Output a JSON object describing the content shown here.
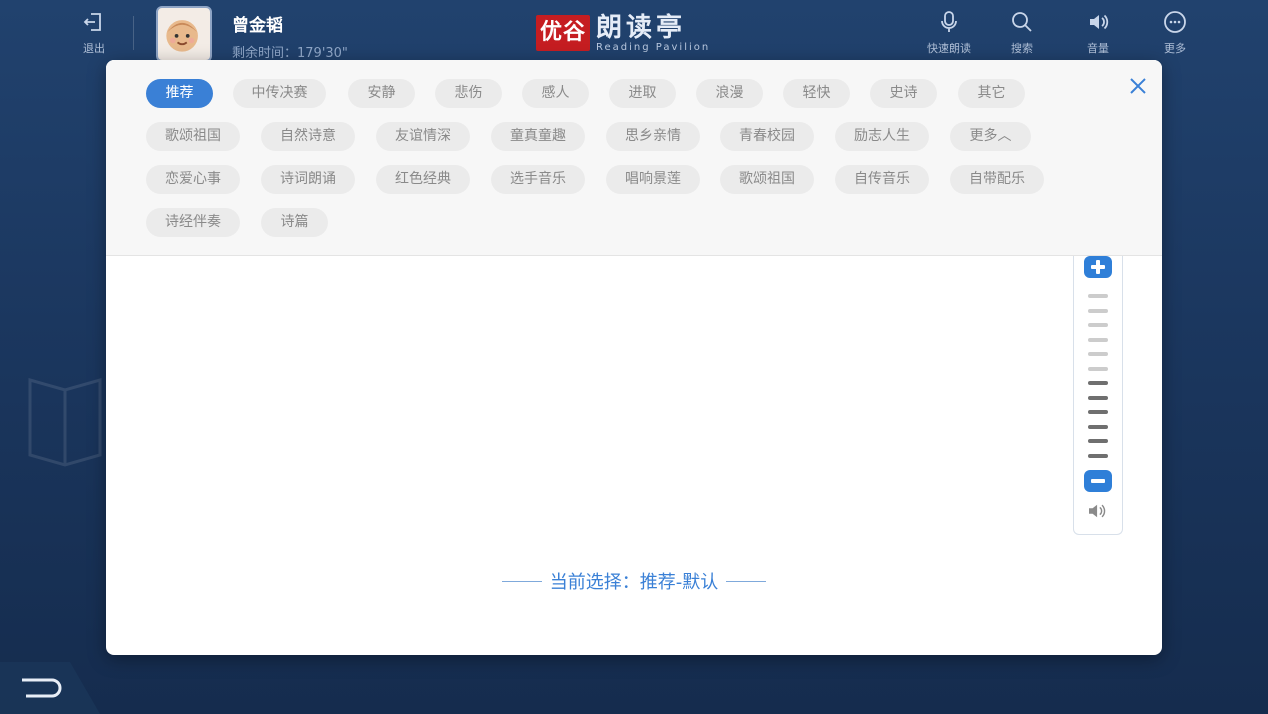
{
  "topbar": {
    "exit_label": "退出",
    "user_name": "曾金韬",
    "remaining_time": "剩余时间：179'30\"",
    "logo_mark": "优谷",
    "logo_cn": "朗读亭",
    "logo_en": "Reading Pavilion",
    "actions": [
      {
        "label": "快速朗读",
        "icon": "microphone-icon"
      },
      {
        "label": "搜索",
        "icon": "search-icon"
      },
      {
        "label": "音量",
        "icon": "volume-icon"
      },
      {
        "label": "更多",
        "icon": "more-icon"
      }
    ]
  },
  "tags": [
    "推荐",
    "中传决赛",
    "安静",
    "悲伤",
    "感人",
    "进取",
    "浪漫",
    "轻快",
    "史诗",
    "其它",
    "歌颂祖国",
    "自然诗意",
    "友谊情深",
    "童真童趣",
    "思乡亲情",
    "青春校园",
    "励志人生",
    "更多︿",
    "恋爱心事",
    "诗词朗诵",
    "红色经典",
    "选手音乐",
    "唱响景莲",
    "歌颂祖国",
    "自传音乐",
    "自带配乐",
    "诗经伴奏",
    "诗篇"
  ],
  "active_tag": "推荐",
  "volume": {
    "level_bars_on": 6,
    "total_bars": 12
  },
  "current_selection": "当前选择：推荐-默认",
  "colors": {
    "accent": "#3a80d6",
    "background": "#1e3a63"
  }
}
